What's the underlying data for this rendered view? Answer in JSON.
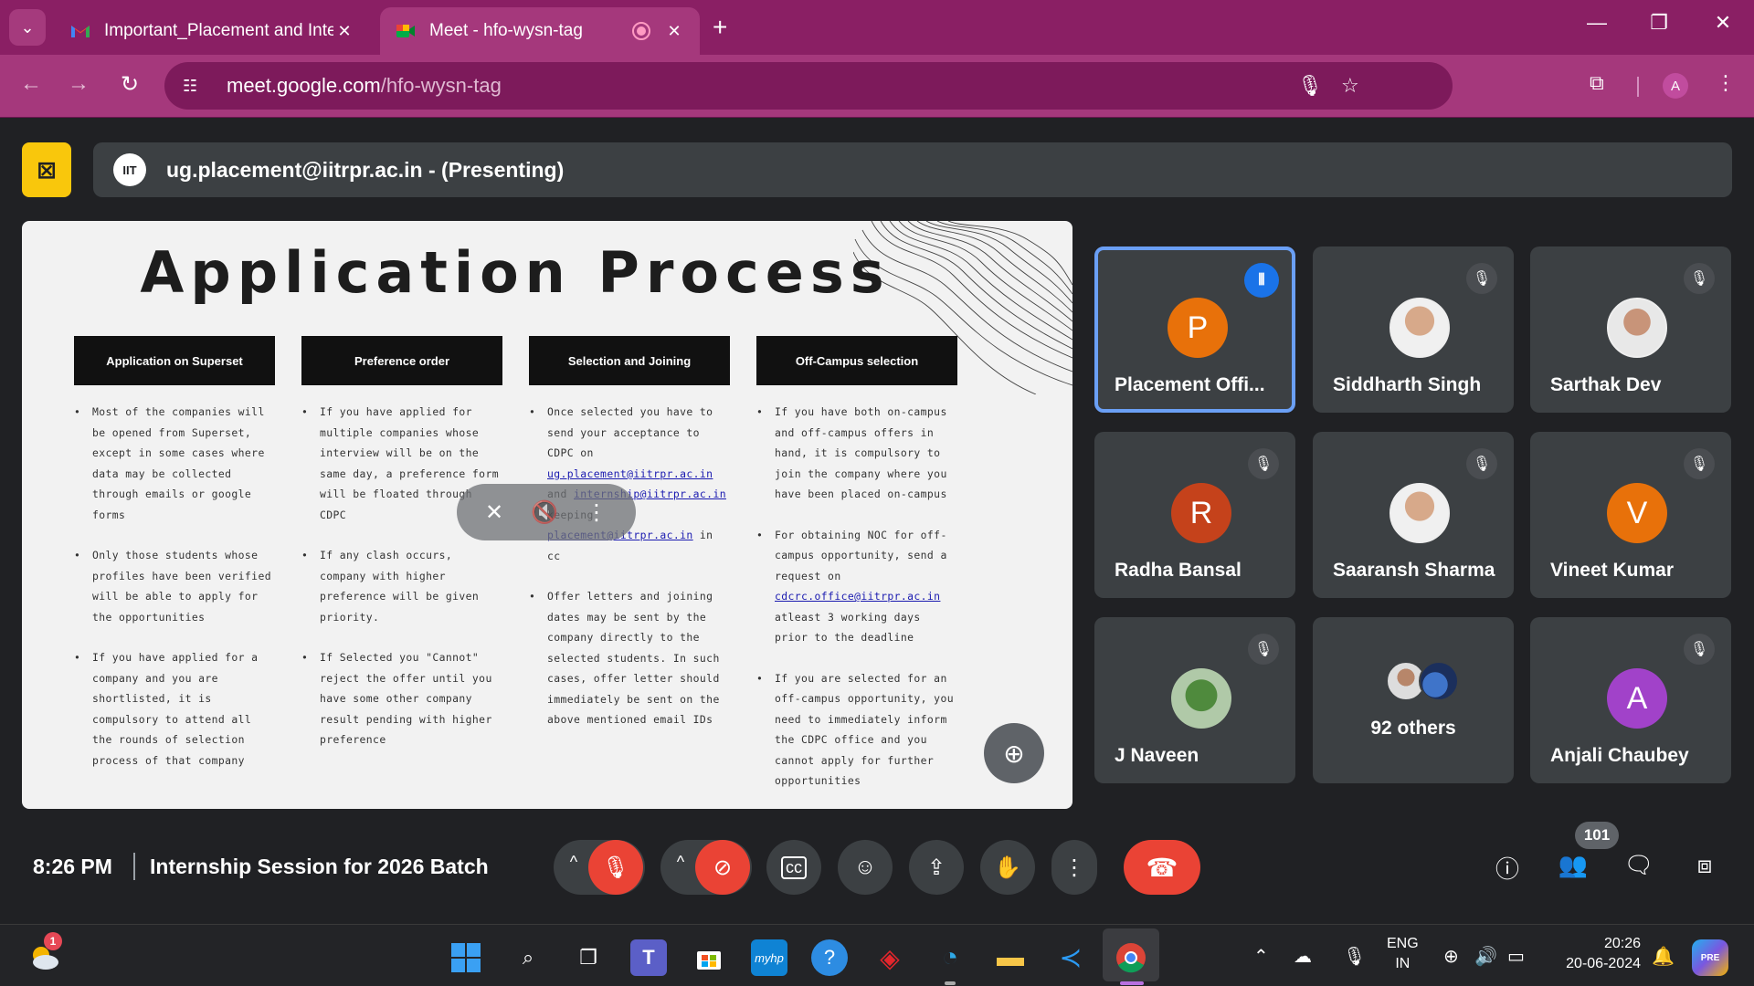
{
  "browser": {
    "tabs": [
      {
        "title": "Important_Placement and Internship",
        "close": "✕"
      },
      {
        "title": "Meet - hfo-wysn-tag",
        "close": "✕"
      }
    ],
    "new_tab": "+",
    "url_host": "meet.google.com",
    "url_path": "/hfo-wysn-tag",
    "profile_initial": "A"
  },
  "meet": {
    "presenter_label": "ug.placement@iitrpr.ac.in - (Presenting)",
    "logo_text": "IIT",
    "time": "8:26 PM",
    "meeting_name": "Internship Session for 2026 Batch",
    "participant_count": "101",
    "participants": [
      {
        "name": "Placement Offi...",
        "initial": "P",
        "color": "#e8710a",
        "speaking": true
      },
      {
        "name": "Siddharth Singh",
        "initial": "",
        "muted": true
      },
      {
        "name": "Sarthak Dev",
        "initial": "",
        "muted": true
      },
      {
        "name": "Radha Bansal",
        "initial": "R",
        "color": "#c5421b",
        "muted": true
      },
      {
        "name": "Saaransh Sharma",
        "initial": "",
        "muted": true
      },
      {
        "name": "Vineet Kumar",
        "initial": "V",
        "color": "#e8710a",
        "muted": true
      },
      {
        "name": "J Naveen",
        "initial": "",
        "muted": true
      },
      {
        "name": "92 others"
      },
      {
        "name": "Anjali Chaubey",
        "initial": "A",
        "color": "#a142c9",
        "muted": true
      }
    ]
  },
  "slide": {
    "title": "Application Process",
    "columns": [
      {
        "heading": "Application on Superset",
        "bullets": [
          "Most of the companies will be opened from Superset, except in some cases where data may be collected through emails or google forms",
          "Only those students whose profiles have been verified will be able to apply for the opportunities",
          "If you have applied for a company and you are shortlisted, it is compulsory to attend all the rounds of selection process of that company"
        ]
      },
      {
        "heading": "Preference order",
        "bullets": [
          "If you have applied for multiple companies whose interview will be on the same day, a preference form will be floated through CDPC",
          "If any clash occurs, company with higher preference will be given priority.",
          "If Selected you \"Cannot\" reject the offer until you have some other company result pending with higher preference"
        ]
      },
      {
        "heading": "Selection and Joining",
        "bullet1_pre": "Once selected you have to send your acceptance to CDPC on ",
        "email1": "ug.placement@iitrpr.ac.in",
        "and": " and ",
        "email2": "internship@iitrpr.ac.in",
        "bullet1_mid": " keeping ",
        "email3": "placement@iitrpr.ac.in",
        "bullet1_post": " in cc",
        "bullet2": "Offer letters and joining dates may be sent by the company directly to the selected students. In such cases, offer letter should immediately be sent on the above mentioned email IDs"
      },
      {
        "heading": "Off-Campus selection",
        "bullet1": "If you have both on-campus and off-campus offers in hand, it is compulsory to join the company where you have been placed on-campus",
        "bullet2_pre": "For obtaining NOC for off-campus opportunity, send a request on ",
        "email": "cdcrc.office@iitrpr.ac.in",
        "bullet2_post": " atleast 3 working days prior to the deadline",
        "bullet3": "If you are selected for an off-campus opportunity, you need to immediately inform the CDPC office and you cannot apply for further opportunities"
      }
    ]
  },
  "taskbar": {
    "lang_top": "ENG",
    "lang_bottom": "IN",
    "time": "20:26",
    "date": "20-06-2024",
    "weather_badge": "1",
    "myhp": "myhp"
  }
}
